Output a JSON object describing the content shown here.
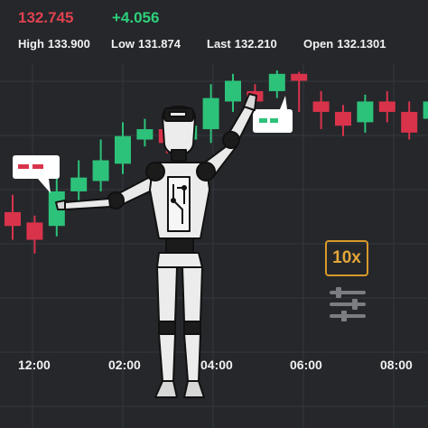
{
  "ticker": {
    "price": "132.745",
    "change": "+4.056",
    "price_color": "#e0424f",
    "change_color": "#2dd07a"
  },
  "stats": {
    "high_label": "High",
    "high_value": "133.900",
    "low_label": "Low",
    "low_value": "131.874",
    "last_label": "Last",
    "last_value": "132.210",
    "open_label": "Open",
    "open_value": "132.1301"
  },
  "time_axis": [
    "12:00",
    "02:00",
    "04:00",
    "06:00",
    "08:00"
  ],
  "zoom_button": {
    "label": "10x",
    "color": "#e3a63a"
  },
  "icons": {
    "settings": "sliders-icon",
    "badge": "indicator-badge-icon"
  },
  "colors": {
    "bull": "#2dc27a",
    "bear": "#d9334b",
    "background": "#25272b",
    "grid": "#34373d"
  },
  "chart_data": {
    "type": "candlestick",
    "series": [
      {
        "open": 131.85,
        "close": 131.65,
        "high": 132.1,
        "low": 131.45
      },
      {
        "open": 131.7,
        "close": 131.45,
        "high": 131.8,
        "low": 131.25
      },
      {
        "open": 131.65,
        "close": 132.15,
        "high": 132.35,
        "low": 131.5
      },
      {
        "open": 132.15,
        "close": 132.35,
        "high": 132.6,
        "low": 132.0
      },
      {
        "open": 132.3,
        "close": 132.6,
        "high": 132.9,
        "low": 132.15
      },
      {
        "open": 132.55,
        "close": 132.95,
        "high": 133.15,
        "low": 132.4
      },
      {
        "open": 132.9,
        "close": 133.05,
        "high": 133.2,
        "low": 132.8
      },
      {
        "open": 133.05,
        "close": 132.85,
        "high": 133.2,
        "low": 132.7
      },
      {
        "open": 132.9,
        "close": 133.1,
        "high": 133.35,
        "low": 132.75
      },
      {
        "open": 133.05,
        "close": 133.5,
        "high": 133.7,
        "low": 132.85
      },
      {
        "open": 133.45,
        "close": 133.75,
        "high": 133.85,
        "low": 133.3
      },
      {
        "open": 133.6,
        "close": 133.45,
        "high": 133.7,
        "low": 133.25
      },
      {
        "open": 133.6,
        "close": 133.85,
        "high": 133.9,
        "low": 133.5
      },
      {
        "open": 133.85,
        "close": 133.75,
        "high": 133.88,
        "low": 133.3
      },
      {
        "open": 133.45,
        "close": 133.3,
        "high": 133.6,
        "low": 133.05
      },
      {
        "open": 133.3,
        "close": 133.1,
        "high": 133.4,
        "low": 132.95
      },
      {
        "open": 133.15,
        "close": 133.45,
        "high": 133.55,
        "low": 133.0
      },
      {
        "open": 133.45,
        "close": 133.3,
        "high": 133.6,
        "low": 133.15
      },
      {
        "open": 133.3,
        "close": 133.0,
        "high": 133.45,
        "low": 132.9
      },
      {
        "open": 133.2,
        "close": 133.45,
        "high": 133.7,
        "low": 133.05
      }
    ],
    "x_ticks": [
      "12:00",
      "02:00",
      "04:00",
      "06:00",
      "08:00"
    ],
    "grid": true
  }
}
